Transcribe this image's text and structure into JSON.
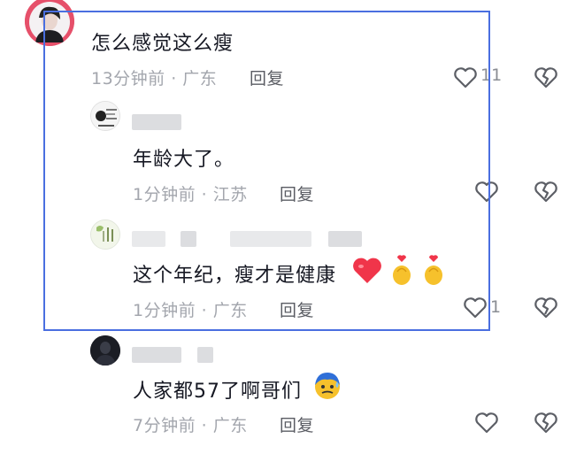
{
  "comments": [
    {
      "text": "怎么感觉这么瘦",
      "meta": "13分钟前 · 广东",
      "reply_label": "回复",
      "likes": "11"
    },
    {
      "text": "年龄大了。",
      "meta": "1分钟前 · 江苏",
      "reply_label": "回复",
      "likes": ""
    },
    {
      "text": "这个年纪，瘦才是健康",
      "meta": "1分钟前 · 广东",
      "reply_label": "回复",
      "likes": "1"
    },
    {
      "text": "人家都57了啊哥们",
      "meta": "7分钟前 · 广东",
      "reply_label": "回复",
      "likes": ""
    }
  ],
  "icons": {
    "like": "heart-outline-icon",
    "dislike": "broken-heart-icon"
  },
  "colors": {
    "highlight_border": "#4a6fe0",
    "meta_text": "#a3a6ad",
    "heart_emoji": "#f0354a",
    "hand_emoji": "#f6c12c"
  }
}
